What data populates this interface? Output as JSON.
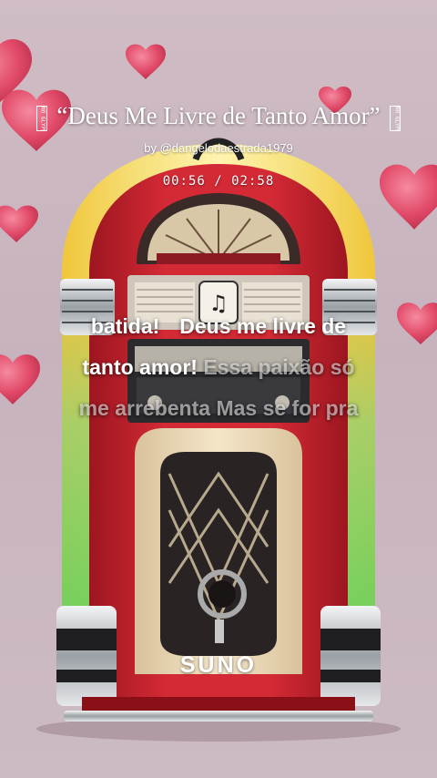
{
  "song": {
    "title": "“Deus Me Livre de Tanto Amor”",
    "title_glyph_left": "NO GLYPH",
    "title_glyph_right": "NO GLYPH",
    "byline": "by @dangelodaestrada1979"
  },
  "player": {
    "time_display": "00:56 / 02:58"
  },
  "lyrics": {
    "line1_a": "batida!",
    "line1_b": "Deus me livre de",
    "line2_active": "tanto amor!",
    "line2_upcoming": "Essa paixão só",
    "line3_upcoming": "me arrebenta Mas se for pra"
  },
  "brand": {
    "logo_text": "SUNO"
  },
  "colors": {
    "background": "#cbb8c1",
    "heart": "#e4546f",
    "jukebox_red": "#c8202c",
    "chrome": "#cfd3d6"
  }
}
